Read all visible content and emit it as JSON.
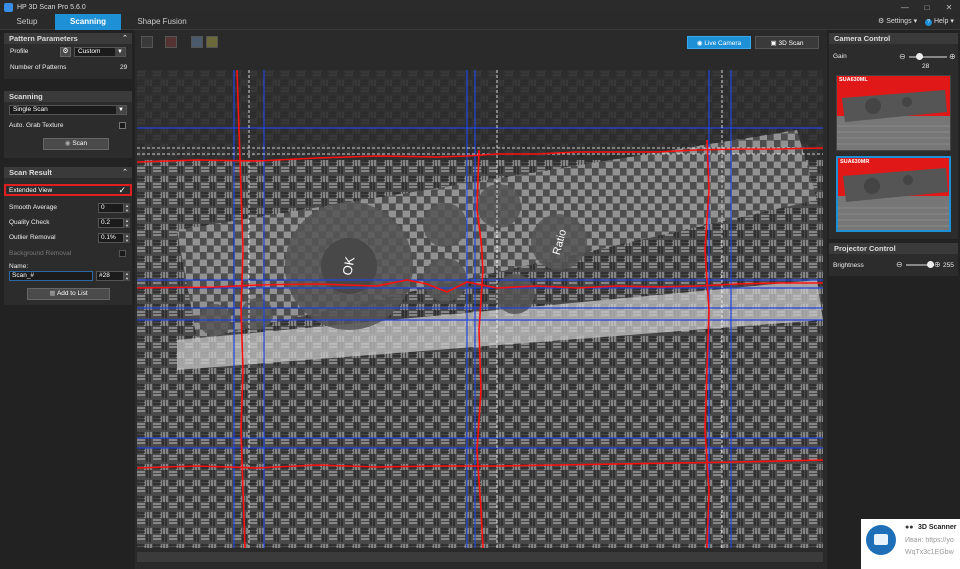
{
  "app": {
    "title": "HP 3D Scan Pro 5.6.0"
  },
  "tabs": [
    {
      "label": "Setup"
    },
    {
      "label": "Scanning"
    },
    {
      "label": "Shape Fusion"
    }
  ],
  "topbar": {
    "settings_label": "Settings",
    "help_label": "Help"
  },
  "pattern_parameters": {
    "header": "Pattern Parameters",
    "profile_label": "Profile",
    "profile_value": "Custom",
    "num_patterns_label": "Number of Patterns",
    "num_patterns_value": "29"
  },
  "scanning": {
    "header": "Scanning",
    "mode_value": "Single Scan",
    "auto_grab_label": "Auto. Grab Texture",
    "scan_button": "Scan"
  },
  "scan_result": {
    "header": "Scan Result",
    "extended_view_label": "Extended View",
    "extended_view_checked": true,
    "smooth_average_label": "Smooth Average",
    "smooth_average_value": "0",
    "quality_check_label": "Quality Check",
    "quality_check_value": "0.2",
    "outlier_removal_label": "Outlier Removal",
    "outlier_removal_value": "0.1%",
    "background_removal_label": "Background Removal",
    "name_label": "Name:",
    "name_value": "Scan_#",
    "name_suffix": "#28",
    "add_to_list_button": "Add to List"
  },
  "view": {
    "live_camera_tab": "Live Camera",
    "scan3d_tab": "3D Scan"
  },
  "remote_buttons": {
    "ok": "OK",
    "ratio": "Ratio"
  },
  "camera_control": {
    "header": "Camera Control",
    "gain_label": "Gain",
    "gain_value": "28",
    "gain_fraction": 0.28,
    "cameras": [
      {
        "label": "SUA630ML"
      },
      {
        "label": "SUA630MR"
      }
    ]
  },
  "projector_control": {
    "header": "Projector Control",
    "brightness_label": "Brightness",
    "brightness_value": "255",
    "brightness_fraction": 1.0
  },
  "notification": {
    "title": "3D Scanner",
    "line1": "Иван: https://yo",
    "line2": "WqTx3c1EGbw"
  },
  "colors": {
    "accent": "#1e90d6",
    "highlight": "#e02020",
    "overlay_red": "#ff1010",
    "overlay_blue": "#2244dd"
  }
}
